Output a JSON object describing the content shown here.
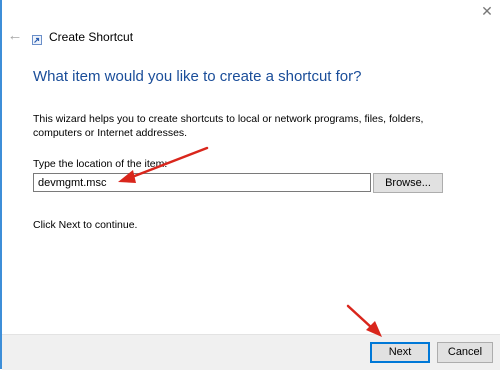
{
  "window": {
    "title": "Create Shortcut",
    "close_glyph": "✕",
    "back_glyph": "←"
  },
  "wizard": {
    "heading": "What item would you like to create a shortcut for?",
    "description": "This wizard helps you to create shortcuts to local or network programs, files, folders, computers or Internet addresses.",
    "field_label": "Type the location of the item:",
    "location_value": "devmgmt.msc",
    "browse_label": "Browse...",
    "hint": "Click Next to continue."
  },
  "footer": {
    "next_label": "Next",
    "cancel_label": "Cancel"
  },
  "colors": {
    "heading": "#1a4d99",
    "annotation_arrow": "#d9261c",
    "window_border": "#3d8ed8"
  },
  "icons": [
    "back-arrow-icon",
    "shortcut-app-icon",
    "close-icon"
  ]
}
